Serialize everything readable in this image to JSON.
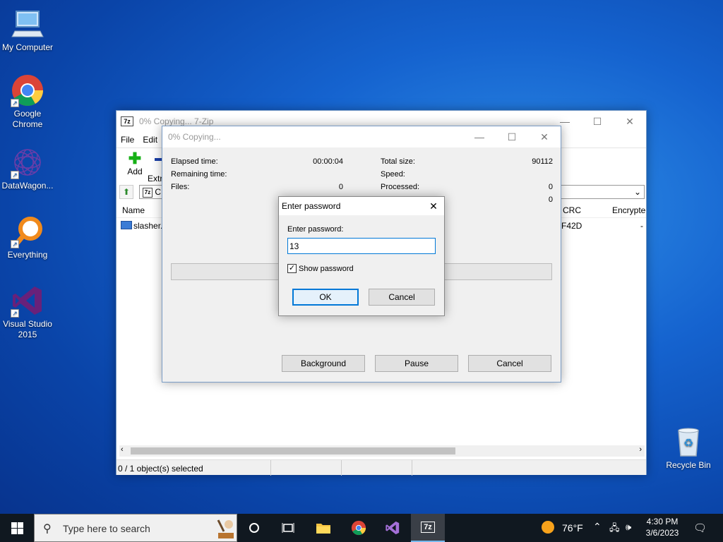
{
  "desktop": {
    "icons": [
      {
        "label": "My Computer"
      },
      {
        "label": "Google Chrome"
      },
      {
        "label": "DataWagon..."
      },
      {
        "label": "Everything"
      },
      {
        "label": "Visual Studio 2015"
      },
      {
        "label": "Recycle Bin"
      }
    ]
  },
  "main_window": {
    "title": "0% Copying... 7-Zip",
    "menu": [
      "File",
      "Edit"
    ],
    "toolbar": {
      "add": "Add",
      "extract": "Extr"
    },
    "address": "C",
    "columns": {
      "name": "Name",
      "crc": "CRC",
      "encrypted": "Encrypte"
    },
    "file": {
      "name": "slasher.e",
      "crc": "F42D",
      "enc": "-"
    },
    "status": "0 / 1 object(s) selected",
    "app_icon": "7z"
  },
  "progress_window": {
    "title": "0% Copying...",
    "left": [
      {
        "label": "Elapsed time:",
        "value": "00:00:04"
      },
      {
        "label": "Remaining time:",
        "value": ""
      },
      {
        "label": "Files:",
        "value": "0"
      }
    ],
    "right": [
      {
        "label": "Total size:",
        "value": "90112"
      },
      {
        "label": "Speed:",
        "value": ""
      },
      {
        "label": "Processed:",
        "value": "0"
      },
      {
        "label": "",
        "value": "0"
      }
    ],
    "buttons": {
      "background": "Background",
      "pause": "Pause",
      "cancel": "Cancel"
    }
  },
  "password_dialog": {
    "title": "Enter password",
    "prompt": "Enter password:",
    "value": "13",
    "show_password": "Show password",
    "show_checked": true,
    "ok": "OK",
    "cancel": "Cancel"
  },
  "taskbar": {
    "search_placeholder": "Type here to search",
    "weather": "76°F",
    "time": "4:30 PM",
    "date": "3/6/2023",
    "app_7z": "7z"
  }
}
